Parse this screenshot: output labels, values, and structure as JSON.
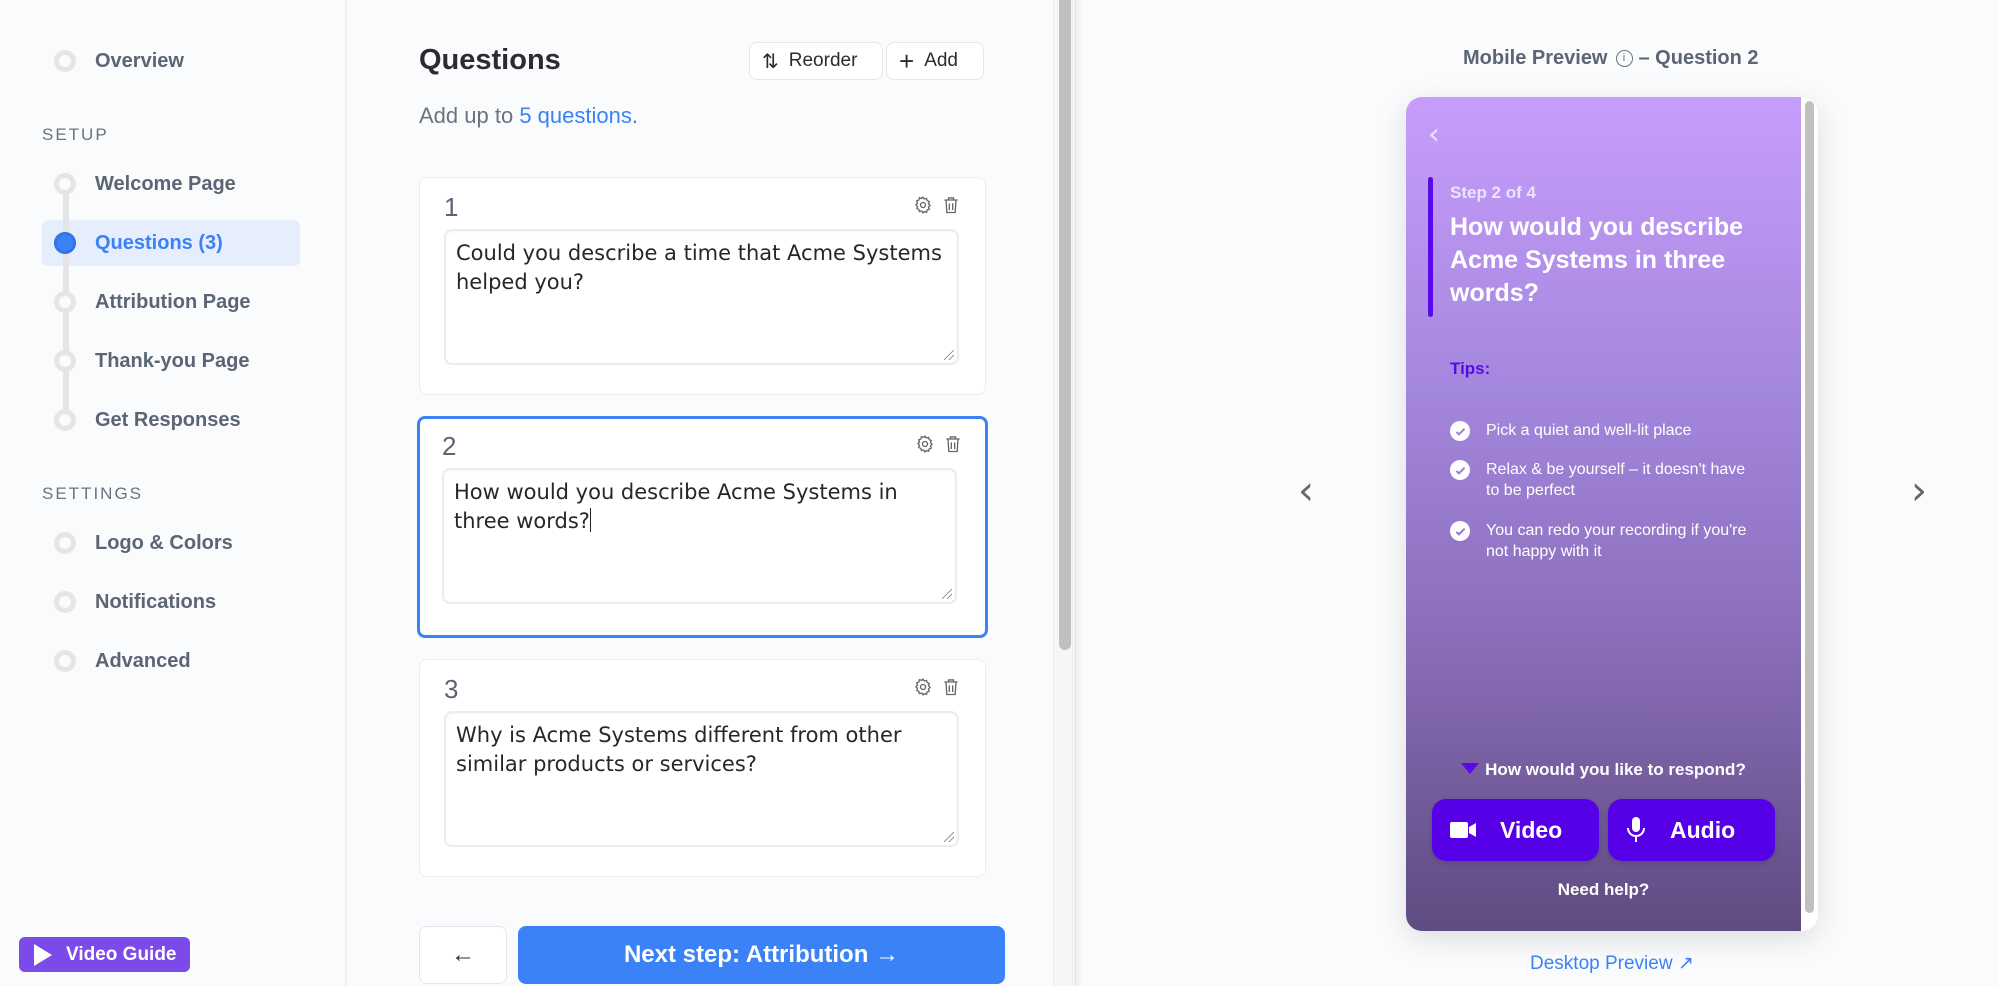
{
  "sidebar": {
    "overview": "Overview",
    "setup_label": "SETUP",
    "setup_items": [
      {
        "label": "Welcome Page",
        "active": false
      },
      {
        "label": "Questions (3)",
        "active": true
      },
      {
        "label": "Attribution Page",
        "active": false
      },
      {
        "label": "Thank-you Page",
        "active": false
      },
      {
        "label": "Get Responses",
        "active": false
      }
    ],
    "settings_label": "SETTINGS",
    "settings_items": [
      {
        "label": "Logo & Colors"
      },
      {
        "label": "Notifications"
      },
      {
        "label": "Advanced"
      }
    ],
    "video_guide": "Video Guide"
  },
  "main": {
    "title": "Questions",
    "reorder_label": "Reorder",
    "add_label": "Add",
    "subtitle_prefix": "Add up to ",
    "subtitle_link": "5 questions",
    "subtitle_suffix": ".",
    "questions": [
      {
        "number": "1",
        "text": "Could you describe a time that Acme Systems helped you?"
      },
      {
        "number": "2",
        "text": "How would you describe Acme Systems in three words?",
        "selected": true
      },
      {
        "number": "3",
        "text": "Why is Acme Systems different from other similar products or services?"
      }
    ],
    "back_label": "←",
    "next_label": "Next step: Attribution →"
  },
  "preview": {
    "title_prefix": "Mobile Preview",
    "title_suffix": "– Question 2",
    "info_icon": "i",
    "step": "Step 2 of 4",
    "question": "How would you describe Acme Systems in three words?",
    "tips_label": "Tips:",
    "tips": [
      "Pick a quiet and well-lit place",
      "Relax & be yourself – it doesn't have to be perfect",
      "You can redo your recording if you're not happy with it"
    ],
    "respond_prompt": "How would you like to respond?",
    "video_label": "Video",
    "audio_label": "Audio",
    "help_label": "Need help?",
    "desktop_link": "Desktop Preview ↗",
    "prev_arrow": "‹",
    "next_arrow": "›",
    "back_arrow": "‹"
  },
  "colors": {
    "accent": "#3b82f6",
    "brand_purple": "#7b4ae8",
    "phone_button": "#5600e8"
  }
}
